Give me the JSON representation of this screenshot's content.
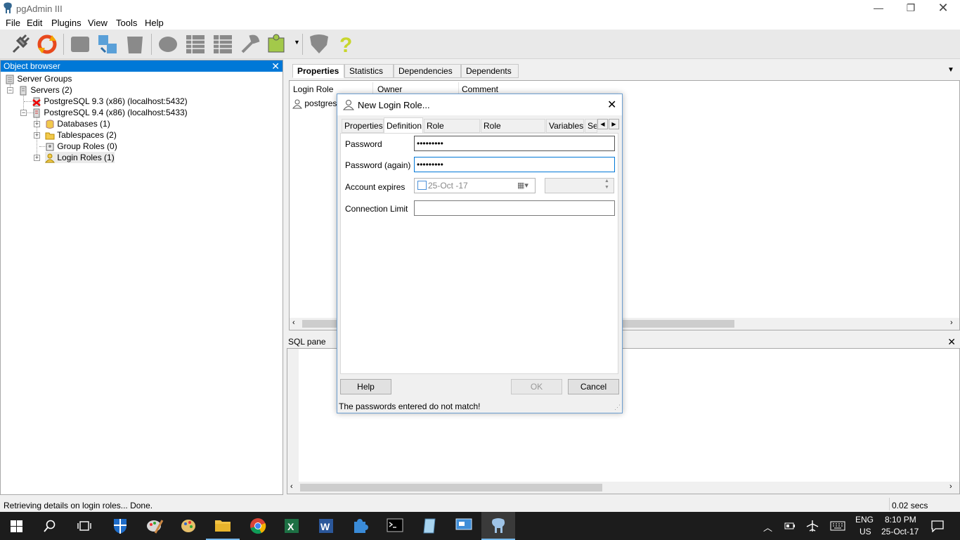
{
  "window": {
    "title": "pgAdmin III"
  },
  "menu": [
    "File",
    "Edit",
    "Plugins",
    "View",
    "Tools",
    "Help"
  ],
  "object_browser": {
    "title": "Object browser",
    "tree": [
      {
        "label": "Server Groups"
      },
      {
        "label": "Servers (2)"
      },
      {
        "label": "PostgreSQL 9.3 (x86) (localhost:5432)"
      },
      {
        "label": "PostgreSQL 9.4 (x86) (localhost:5433)"
      },
      {
        "label": "Databases (1)"
      },
      {
        "label": "Tablespaces (2)"
      },
      {
        "label": "Group Roles (0)"
      },
      {
        "label": "Login Roles (1)"
      }
    ]
  },
  "properties": {
    "tabs": [
      "Properties",
      "Statistics",
      "Dependencies",
      "Dependents"
    ],
    "columns": [
      "Login Role",
      "Owner",
      "Comment"
    ],
    "rows": [
      {
        "login_role": "postgres"
      }
    ]
  },
  "sql_pane": {
    "title": "SQL pane"
  },
  "status": {
    "message": "Retrieving details on login roles... Done.",
    "time": "0.02 secs"
  },
  "dialog": {
    "title": "New Login Role...",
    "tabs": [
      "Properties",
      "Definition",
      "Role privileges",
      "Role membership",
      "Variables",
      "Se"
    ],
    "selected_tab": "Definition",
    "password_label": "Password",
    "password_value": "•••••••••",
    "password_again_label": "Password (again)",
    "password_again_value": "•••••••••",
    "account_expires_label": "Account expires",
    "account_expires_value": "25-Oct -17",
    "connection_limit_label": "Connection Limit",
    "connection_limit_value": "",
    "help_label": "Help",
    "ok_label": "OK",
    "cancel_label": "Cancel",
    "status_message": "The passwords entered do not match!"
  },
  "taskbar": {
    "lang_top": "ENG",
    "lang_bottom": "US",
    "time": "8:10 PM",
    "date": "25-Oct-17"
  },
  "colors": {
    "accent": "#0078d7",
    "taskbar": "#1c1c1c"
  }
}
